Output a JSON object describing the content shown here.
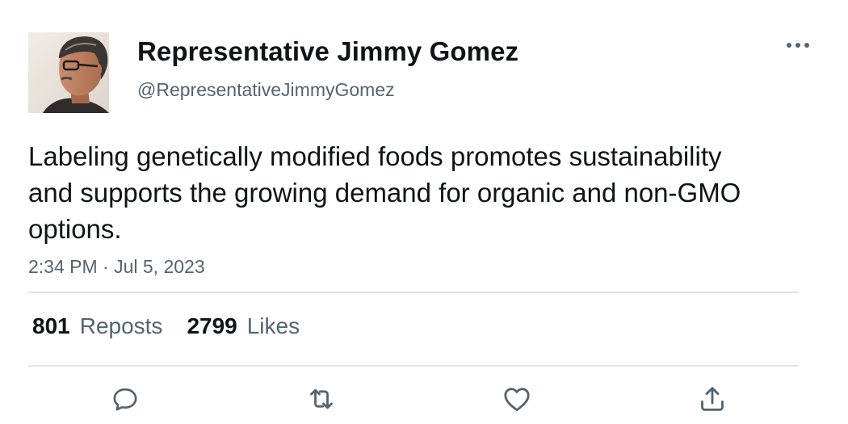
{
  "author": {
    "display_name": "Representative Jimmy Gomez",
    "handle": "@RepresentativeJimmyGomez",
    "avatar_icon": "profile-photo"
  },
  "tweet": {
    "text": "Labeling genetically modified foods promotes sustainability and supports the growing demand for organic and non-GMO options.",
    "timestamp": "2:34 PM · Jul 5, 2023"
  },
  "stats": {
    "reposts_count": "801",
    "reposts_label": "Reposts",
    "likes_count": "2799",
    "likes_label": "Likes"
  },
  "actions": [
    {
      "name": "reply",
      "icon": "speech-bubble-icon"
    },
    {
      "name": "repost",
      "icon": "repost-arrows-icon"
    },
    {
      "name": "like",
      "icon": "heart-icon"
    },
    {
      "name": "share",
      "icon": "share-upload-icon"
    }
  ],
  "colors": {
    "text_primary": "#0f1419",
    "text_secondary": "#536471",
    "divider": "#e1e4e6",
    "icon": "#536471"
  }
}
